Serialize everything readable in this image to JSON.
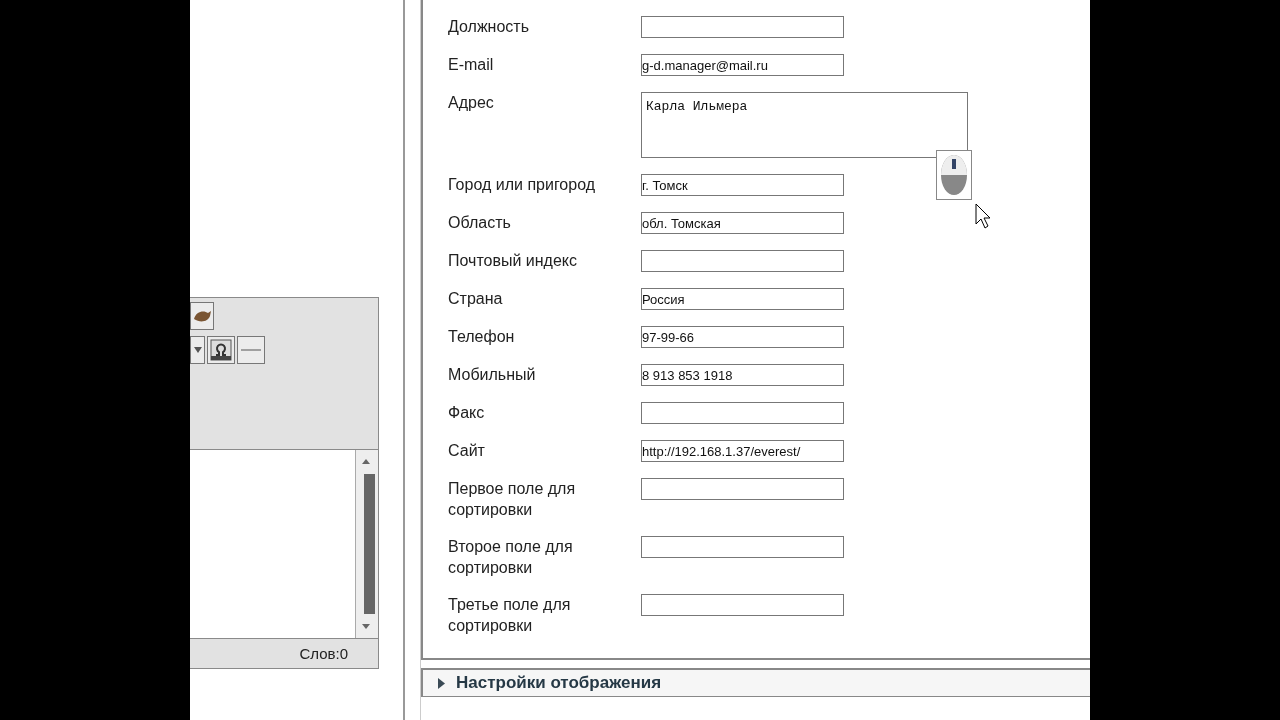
{
  "editor": {
    "word_count": "Слов:0"
  },
  "form": {
    "fields": [
      {
        "label": "Должность",
        "kind": "input"
      },
      {
        "label": "E-mail",
        "kind": "input",
        "value": "g-d.manager@mail.ru"
      },
      {
        "label": "Адрес",
        "kind": "textarea",
        "value": "Карла Ильмера"
      },
      {
        "label": "Город или пригород",
        "kind": "input",
        "value": "г. Томск"
      },
      {
        "label": "Область",
        "kind": "input",
        "value": "обл. Томская"
      },
      {
        "label": "Почтовый индекс",
        "kind": "input"
      },
      {
        "label": "Страна",
        "kind": "input",
        "value": "Россия"
      },
      {
        "label": "Телефон",
        "kind": "input",
        "value": "97-99-66"
      },
      {
        "label": "Мобильный",
        "kind": "input",
        "value": "8 913 853 1918"
      },
      {
        "label": "Факс",
        "kind": "input"
      },
      {
        "label": "Сайт",
        "kind": "input",
        "value": "http://192.168.1.37/everest/"
      },
      {
        "label": "Первое поле для сортировки",
        "kind": "input"
      },
      {
        "label": "Второе поле для сортировки",
        "kind": "input"
      },
      {
        "label": "Третье поле для сортировки",
        "kind": "input"
      }
    ]
  },
  "section": {
    "title": "Настройки отображения",
    "expanded": false
  }
}
